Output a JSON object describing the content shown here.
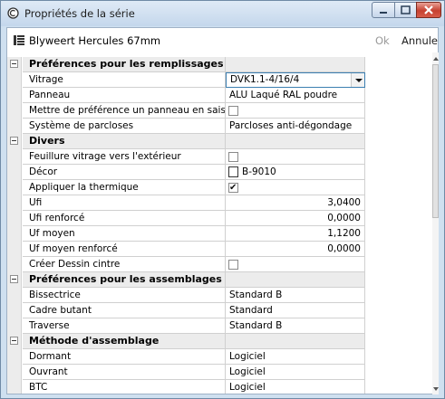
{
  "window": {
    "title": "Propriétés de la série",
    "icon": "app-icon"
  },
  "toolbar": {
    "title": "Blyweert Hercules 67mm",
    "icon": "grid-icon",
    "ok_label": "Ok",
    "cancel_label": "Annuler"
  },
  "grid": {
    "rows": [
      {
        "type": "category",
        "label": "Préférences pour les remplissages"
      },
      {
        "type": "dropdown",
        "label": "Vitrage",
        "value": "DVK1.1-4/16/4"
      },
      {
        "type": "text",
        "label": "Panneau",
        "value": "ALU Laqué RAL poudre"
      },
      {
        "type": "checkbox",
        "label": "Mettre de préférence un panneau en saisie",
        "checked": false
      },
      {
        "type": "text",
        "label": "Système de parcloses",
        "value": "Parcloses anti-dégondage"
      },
      {
        "type": "category",
        "label": "Divers"
      },
      {
        "type": "checkbox",
        "label": "Feuillure vitrage vers l'extérieur",
        "checked": false
      },
      {
        "type": "color",
        "label": "Décor",
        "value": "B-9010"
      },
      {
        "type": "checkbox",
        "label": "Appliquer la thermique",
        "checked": true
      },
      {
        "type": "number",
        "label": "Ufi",
        "value": "3,0400"
      },
      {
        "type": "number",
        "label": "Ufi renforcé",
        "value": "0,0000"
      },
      {
        "type": "number",
        "label": "Uf moyen",
        "value": "1,1200"
      },
      {
        "type": "number",
        "label": "Uf moyen renforcé",
        "value": "0,0000"
      },
      {
        "type": "checkbox",
        "label": "Créer Dessin cintre",
        "checked": false
      },
      {
        "type": "category",
        "label": "Préférences pour les assemblages"
      },
      {
        "type": "text",
        "label": "Bissectrice",
        "value": "Standard B"
      },
      {
        "type": "text",
        "label": "Cadre butant",
        "value": "Standard"
      },
      {
        "type": "text",
        "label": "Traverse",
        "value": "Standard B"
      },
      {
        "type": "category",
        "label": "Méthode d'assemblage"
      },
      {
        "type": "text",
        "label": "Dormant",
        "value": "Logiciel"
      },
      {
        "type": "text",
        "label": "Ouvrant",
        "value": "Logiciel"
      },
      {
        "type": "text",
        "label": "BTC",
        "value": "Logiciel"
      }
    ]
  },
  "colors": {
    "category_bg": "#ececec",
    "dropdown_border": "#3c7fb1",
    "close_button": "#c64130"
  }
}
